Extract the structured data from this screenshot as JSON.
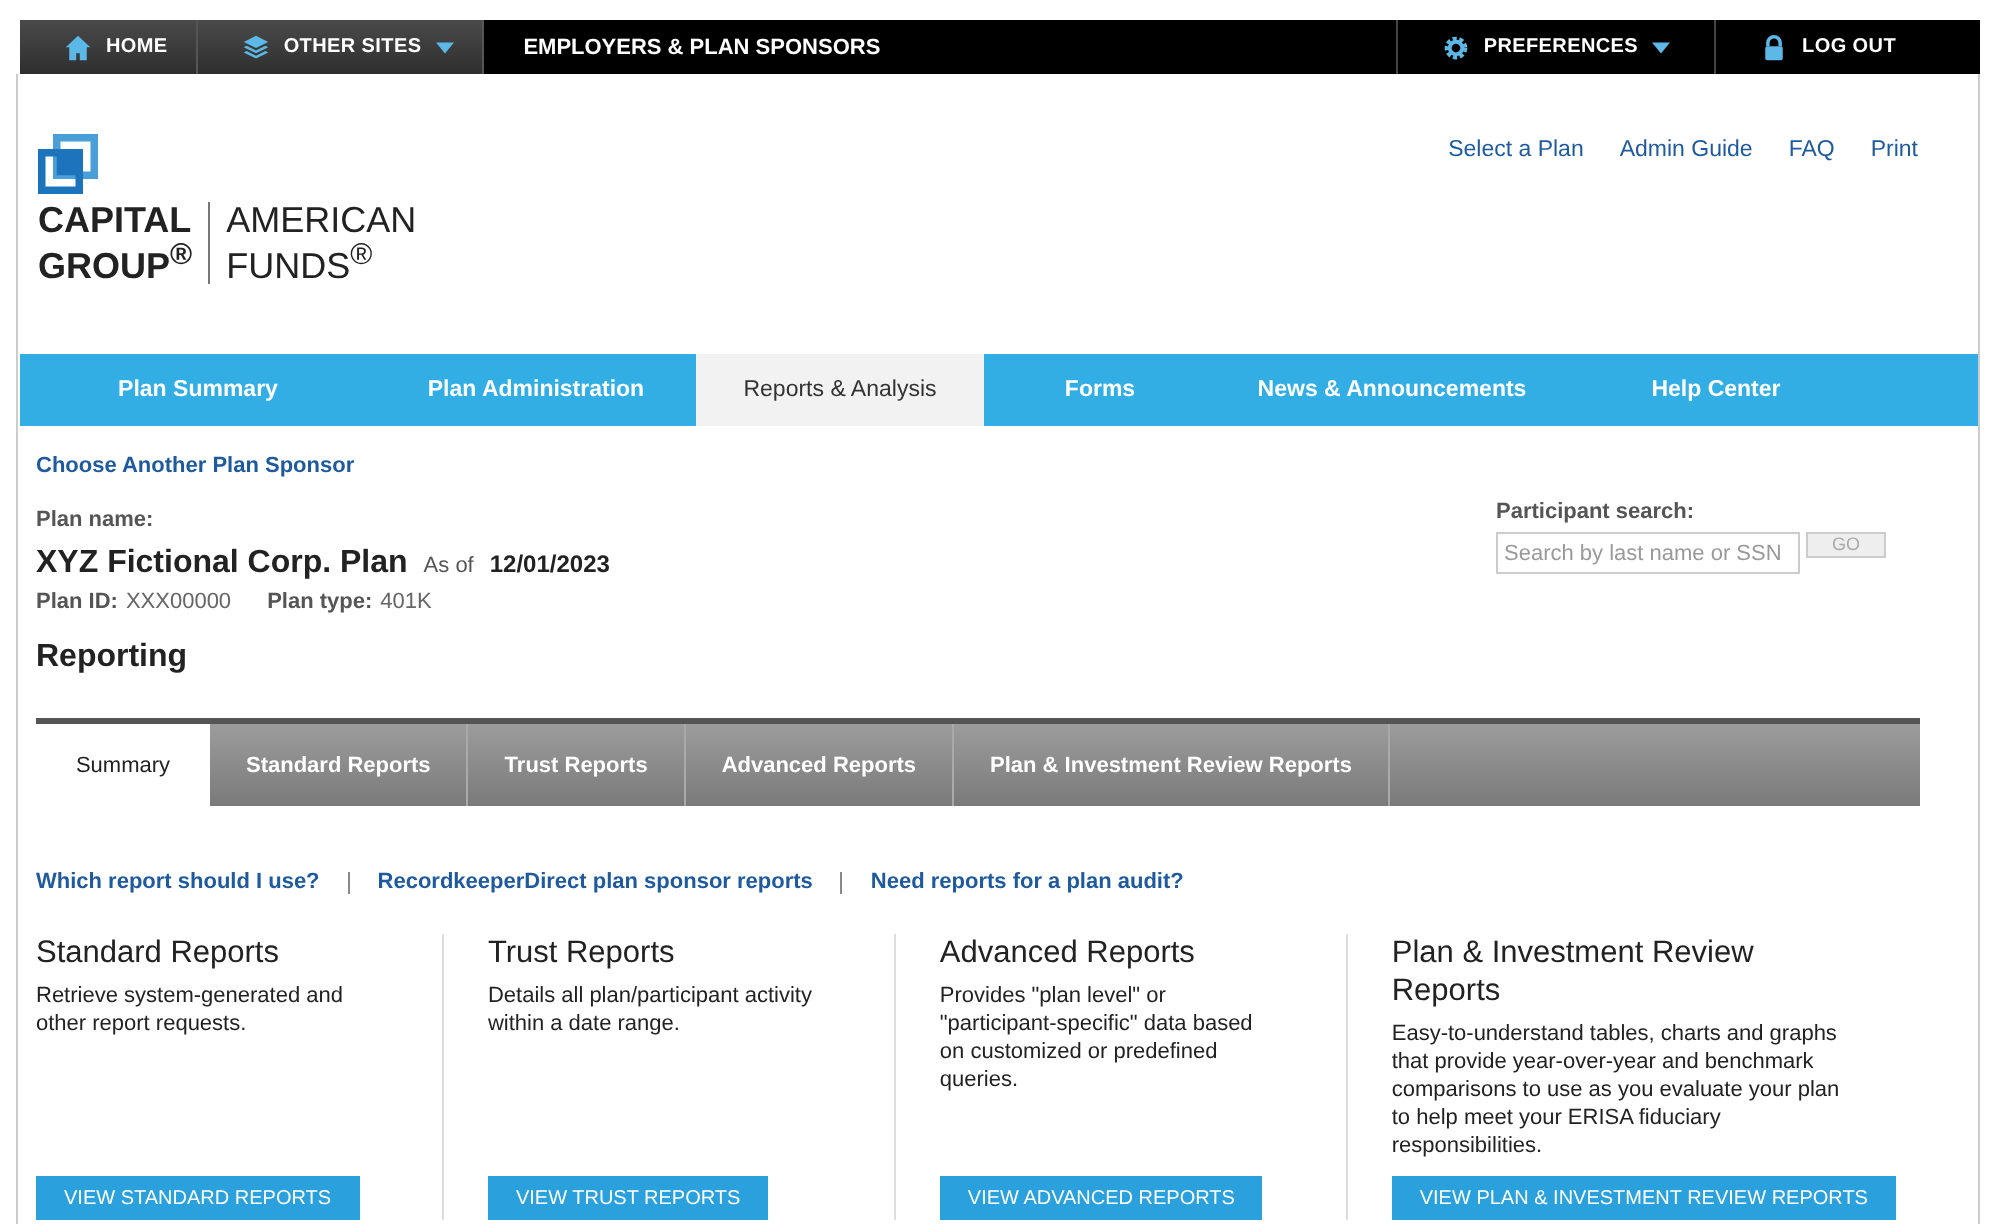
{
  "top_bar": {
    "left": [
      {
        "label": "HOME",
        "kind": "home",
        "dropdown": false
      },
      {
        "label": "OTHER SITES",
        "kind": "layers",
        "dropdown": true
      }
    ],
    "site_title": "EMPLOYERS & PLAN SPONSORS",
    "right": [
      {
        "label": "PREFERENCES",
        "kind": "gear",
        "dropdown": true
      },
      {
        "label": "LOG OUT",
        "kind": "lock",
        "dropdown": false
      }
    ]
  },
  "logo": {
    "line1a": "CAPITAL",
    "line1b": "GROUP$^{®}$",
    "line2a": "AMERICAN",
    "line2b": "FUNDS$^{®}$"
  },
  "header_links": [
    "Select a Plan",
    "Admin Guide",
    "FAQ",
    "Print"
  ],
  "nav": [
    {
      "label": "Plan Summary",
      "selected": false
    },
    {
      "label": "Plan Administration",
      "selected": false
    },
    {
      "label": "Reports & Analysis",
      "selected": true
    },
    {
      "label": "Forms",
      "selected": false
    },
    {
      "label": "News & Announcements",
      "selected": false
    },
    {
      "label": "Help Center",
      "selected": false
    }
  ],
  "choose_link": "Choose Another Plan Sponsor",
  "plan": {
    "name_label": "Plan name:",
    "name": "XYZ Fictional Corp. Plan",
    "as_of_label": "As of",
    "as_of": "12/01/2023",
    "id_label": "Plan ID:",
    "id": "XXX00000",
    "type_label": "Plan type:",
    "type": "401K"
  },
  "participant_search": {
    "label": "Participant search:",
    "placeholder": "Search by last name or SSN",
    "button": "GO"
  },
  "page_title": "Reporting",
  "tabs": [
    {
      "label": "Summary",
      "selected": true
    },
    {
      "label": "Standard Reports",
      "selected": false
    },
    {
      "label": "Trust Reports",
      "selected": false
    },
    {
      "label": "Advanced Reports",
      "selected": false
    },
    {
      "label": "Plan & Investment Review Reports",
      "selected": false
    }
  ],
  "help_links": [
    "Which report should I use?",
    "RecordkeeperDirect plan sponsor reports",
    "Need reports for a plan audit?"
  ],
  "report_cards": [
    {
      "title": "Standard Reports",
      "description": "Retrieve system-generated and other report requests.",
      "button": "VIEW STANDARD REPORTS"
    },
    {
      "title": "Trust Reports",
      "description": "Details all plan/participant activity within a date range.",
      "button": "VIEW TRUST REPORTS"
    },
    {
      "title": "Advanced Reports",
      "description": "Provides \"plan level\" or \"participant-specific\" data based on customized or predefined queries.",
      "button": "VIEW ADVANCED REPORTS"
    },
    {
      "title": "Plan & Investment Review Reports",
      "description": "Easy-to-understand tables, charts and graphs that provide year-over-year and benchmark comparisons to use as you evaluate your plan to help meet your ERISA fiduciary responsibilities.",
      "button": "VIEW PLAN & INVESTMENT REVIEW REPORTS"
    }
  ]
}
